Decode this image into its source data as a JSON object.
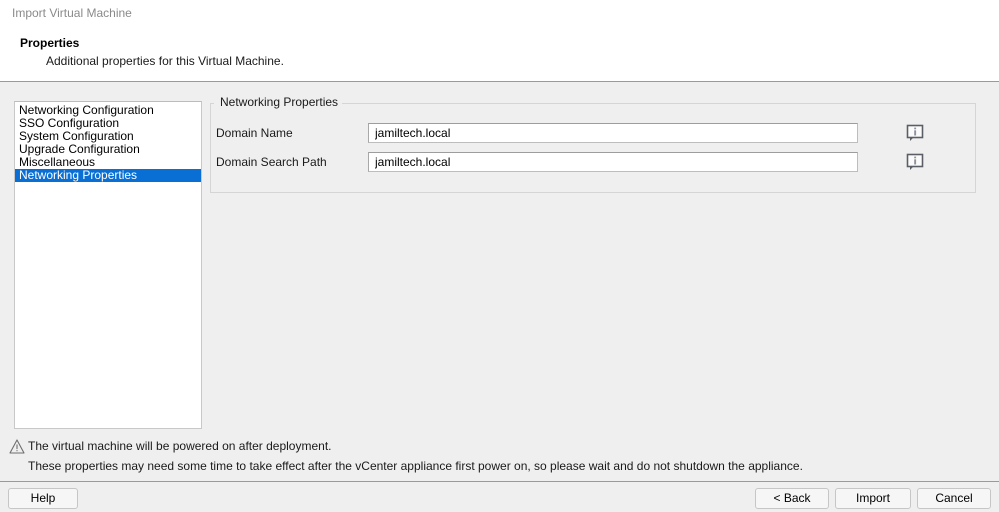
{
  "window": {
    "title": "Import Virtual Machine"
  },
  "header": {
    "title": "Properties",
    "subtitle": "Additional properties for this Virtual Machine."
  },
  "sidebar": {
    "items": [
      {
        "label": "Networking Configuration",
        "selected": false
      },
      {
        "label": "SSO Configuration",
        "selected": false
      },
      {
        "label": "System Configuration",
        "selected": false
      },
      {
        "label": "Upgrade Configuration",
        "selected": false
      },
      {
        "label": "Miscellaneous",
        "selected": false
      },
      {
        "label": "Networking Properties",
        "selected": true
      }
    ],
    "highlight_color": "#0a6fd4"
  },
  "main": {
    "group_legend": "Networking Properties",
    "fields": [
      {
        "label": "Domain Name",
        "value": "jamiltech.local",
        "placeholder": "",
        "info_icon": "info-callout-icon"
      },
      {
        "label": "Domain Search Path",
        "value": "jamiltech.local",
        "placeholder": "",
        "info_icon": "info-callout-icon"
      }
    ]
  },
  "notice": {
    "icon": "warning-triangle-icon",
    "line1": "The virtual machine will be powered on after deployment.",
    "line2": "These properties may need some time to take effect after the vCenter appliance first power on, so please wait and do not shutdown the appliance."
  },
  "footer": {
    "help_label": "Help",
    "back_label": "< Back",
    "import_label": "Import",
    "cancel_label": "Cancel"
  }
}
